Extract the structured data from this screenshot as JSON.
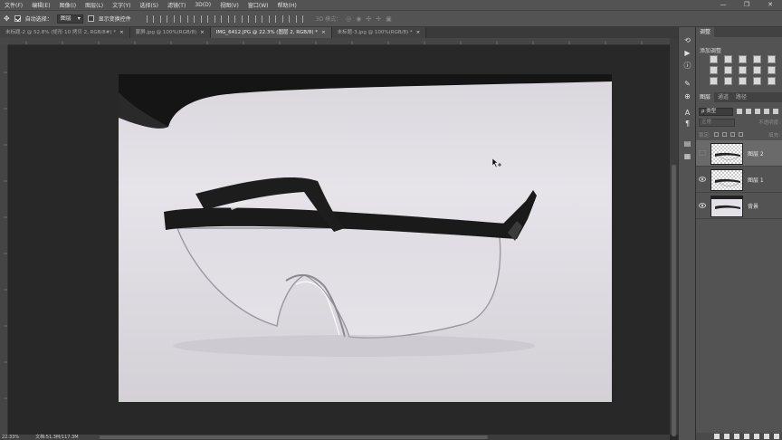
{
  "menubar": {
    "items": [
      "文件(F)",
      "编辑(E)",
      "图像(I)",
      "图层(L)",
      "文字(Y)",
      "选择(S)",
      "滤镜(T)",
      "3D(D)",
      "视图(V)",
      "窗口(W)",
      "帮助(H)"
    ],
    "window_controls": [
      "—",
      "❐",
      "✕"
    ]
  },
  "options_bar": {
    "auto_select_label": "自动选择：",
    "auto_select_checked": true,
    "target_value": "图层",
    "show_transform_label": "显示变换控件",
    "show_transform_checked": false,
    "mode_3d_label": "3D 模式："
  },
  "document_tabs": [
    {
      "label": "未标题-2 @ 52.8% (矩形 10 拷贝 2, RGB/8#) *",
      "active": false
    },
    {
      "label": "蒙屏.jpg @ 100%(RGB/8)",
      "active": false
    },
    {
      "label": "IMG_6412.JPG @ 22.3% (图层 2, RGB/8) *",
      "active": true
    },
    {
      "label": "未标题-3.jpg @ 100%(RGB/8) *",
      "active": false
    }
  ],
  "status_bar": {
    "zoom": "22.33%",
    "doc_info": "文档:51.3M/117.3M"
  },
  "adjustments_panel": {
    "tab": "调整",
    "title": "添加调整"
  },
  "layers_panel": {
    "tabs": [
      "图层",
      "通道",
      "路径"
    ],
    "filter_kind": "ρ 类型",
    "blend_mode": "正常",
    "opacity_label": "不透明度:",
    "lock_label": "锁定:",
    "fill_label": "填充:",
    "layers": [
      {
        "name": "图层 2",
        "visible": false,
        "active": true,
        "transparent": true
      },
      {
        "name": "图层 1",
        "visible": true,
        "active": false,
        "transparent": true
      },
      {
        "name": "背景",
        "visible": true,
        "active": false,
        "transparent": false
      }
    ]
  },
  "colors": {
    "ui_dark": "#282828",
    "ui_mid": "#535353",
    "photo_bg": "#e6e4e9"
  }
}
